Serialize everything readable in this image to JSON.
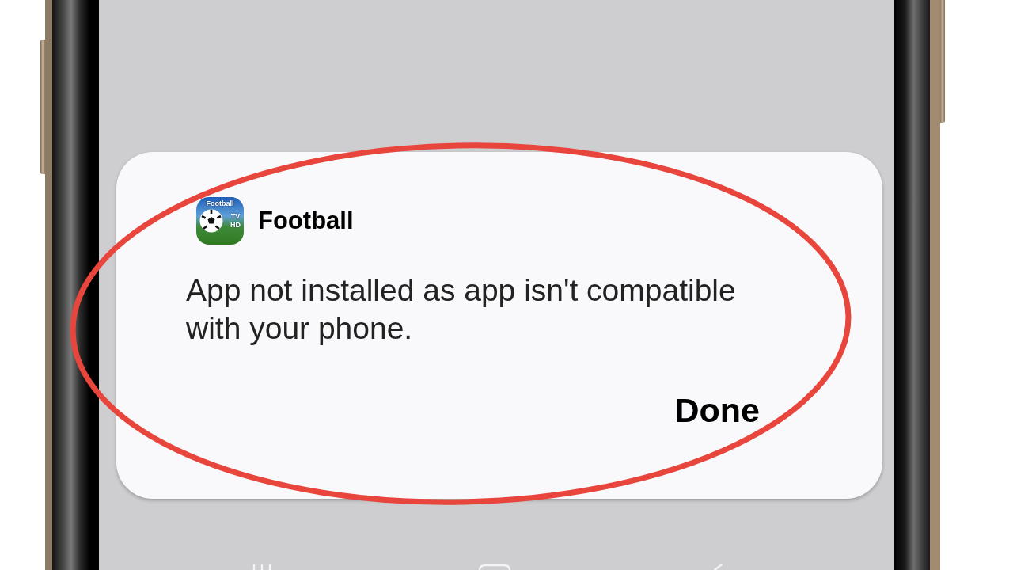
{
  "dialog": {
    "app": {
      "name": "Football",
      "icon_text": [
        "Football",
        "TV",
        "HD"
      ]
    },
    "message": "App not installed as app isn't compatible with your phone.",
    "buttons": [
      "Done"
    ]
  }
}
